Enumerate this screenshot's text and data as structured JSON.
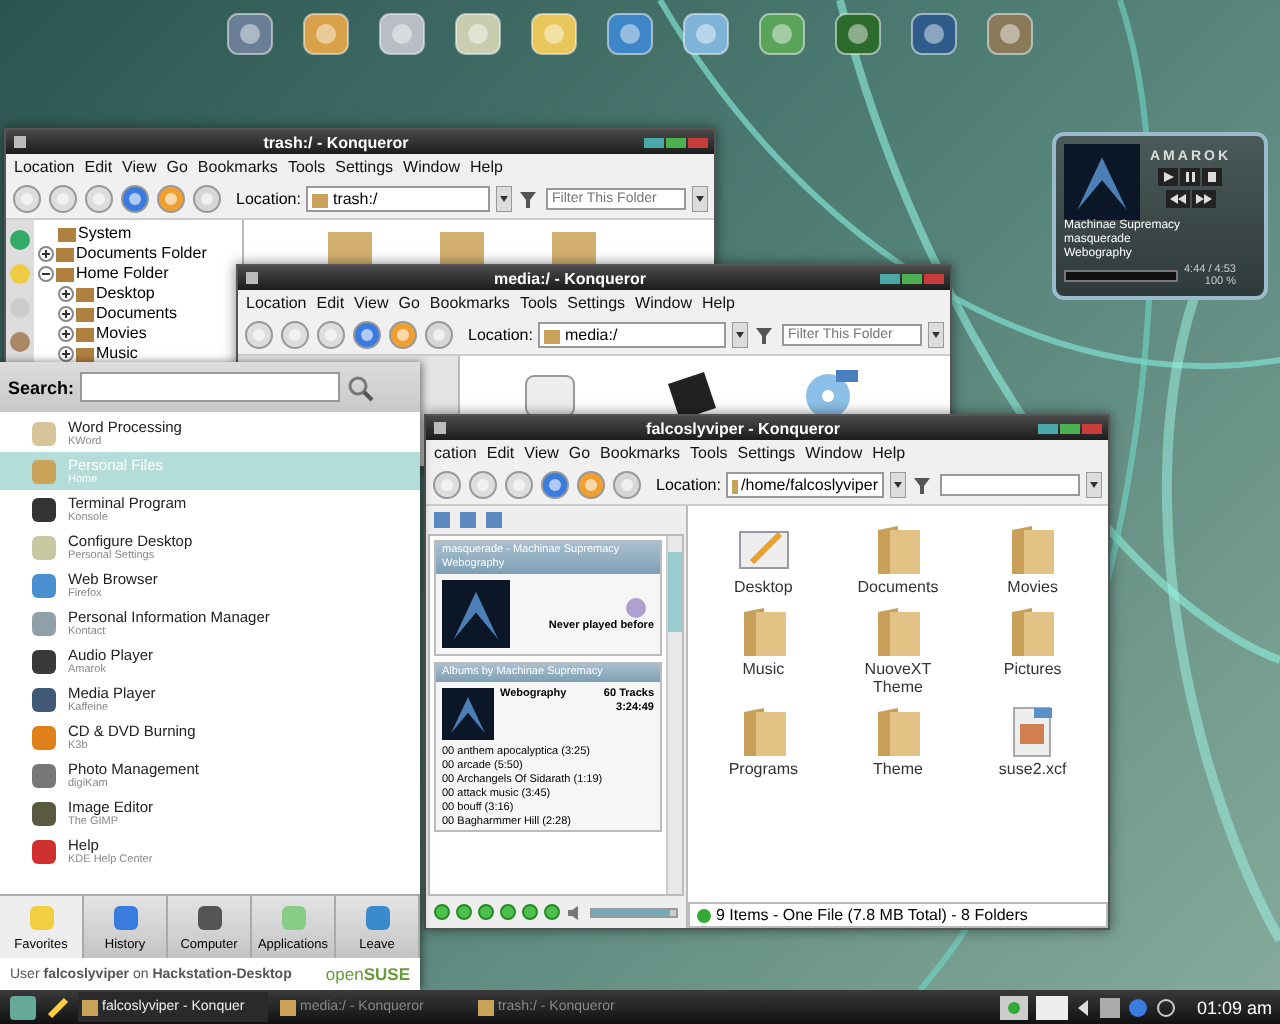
{
  "amarok_widget": {
    "logo": "AMAROK",
    "artist": "Machinae Supremacy",
    "track": "masquerade",
    "album": "Webography",
    "time": "4:44 / 4:53",
    "volume": "100 %"
  },
  "trash_window": {
    "title": "trash:/ - Konqueror",
    "menu": [
      "Location",
      "Edit",
      "View",
      "Go",
      "Bookmarks",
      "Tools",
      "Settings",
      "Window",
      "Help"
    ],
    "location_label": "Location:",
    "location": "trash:/",
    "filter_placeholder": "Filter This Folder",
    "tree": [
      {
        "label": "System"
      },
      {
        "label": "Documents Folder",
        "expanded": false
      },
      {
        "label": "Home Folder",
        "expanded": true,
        "children": [
          {
            "label": "Desktop",
            "expanded": false
          },
          {
            "label": "Documents",
            "expanded": false
          },
          {
            "label": "Movies",
            "expanded": false
          },
          {
            "label": "Music",
            "expanded": false
          }
        ]
      }
    ]
  },
  "media_window": {
    "title": "media:/ - Konqueror",
    "menu": [
      "Location",
      "Edit",
      "View",
      "Go",
      "Bookmarks",
      "Tools",
      "Settings",
      "Window",
      "Help"
    ],
    "location_label": "Location:",
    "location": "media:/",
    "filter_placeholder": "Filter This Folder"
  },
  "home_window": {
    "title": "falcoslyviper - Konqueror",
    "menu": [
      "cation",
      "Edit",
      "View",
      "Go",
      "Bookmarks",
      "Tools",
      "Settings",
      "Window",
      "Help"
    ],
    "location_label": "Location:",
    "location": "/home/falcoslyviper",
    "now_playing": {
      "header": "masquerade - Machinae Supremacy",
      "subheader": "Webography",
      "play_note": "Never played before"
    },
    "albums": {
      "header": "Albums by Machinae Supremacy",
      "album": "Webography",
      "track_count": "60 Tracks",
      "length": "3:24:49",
      "tracks": [
        "00  anthem apocalyptica (3:25)",
        "00  arcade (5:50)",
        "00  Archangels Of Sidarath (1:19)",
        "00  attack music (3:45)",
        "00  bouff (3:16)",
        "00  Bagharmmer Hill (2:28)"
      ]
    },
    "volume": {
      "level": 0.93
    },
    "files": [
      {
        "name": "Desktop",
        "kind": "desktop"
      },
      {
        "name": "Documents",
        "kind": "folder"
      },
      {
        "name": "Movies",
        "kind": "folder"
      },
      {
        "name": "Music",
        "kind": "folder"
      },
      {
        "name": "NuoveXT Theme",
        "kind": "folder"
      },
      {
        "name": "Pictures",
        "kind": "folder"
      },
      {
        "name": "Programs",
        "kind": "folder"
      },
      {
        "name": "Theme",
        "kind": "folder"
      },
      {
        "name": "suse2.xcf",
        "kind": "file"
      }
    ],
    "status": "9 Items - One File (7.8 MB Total) - 8 Folders"
  },
  "start_menu": {
    "search_label": "Search:",
    "items": [
      {
        "name": "Word Processing",
        "description": "KWord",
        "selected": false
      },
      {
        "name": "Personal Files",
        "description": "Home",
        "selected": true
      },
      {
        "name": "Terminal Program",
        "description": "Konsole",
        "selected": false
      },
      {
        "name": "Configure Desktop",
        "description": "Personal Settings",
        "selected": false
      },
      {
        "name": "Web Browser",
        "description": "Firefox",
        "selected": false
      },
      {
        "name": "Personal Information Manager",
        "description": "Kontact",
        "selected": false
      },
      {
        "name": "Audio Player",
        "description": "Amarok",
        "selected": false
      },
      {
        "name": "Media Player",
        "description": "Kaffeine",
        "selected": false
      },
      {
        "name": "CD & DVD Burning",
        "description": "K3b",
        "selected": false
      },
      {
        "name": "Photo Management",
        "description": "digiKam",
        "selected": false
      },
      {
        "name": "Image Editor",
        "description": "The GIMP",
        "selected": false
      },
      {
        "name": "Help",
        "description": "KDE Help Center",
        "selected": false
      }
    ],
    "tabs": [
      {
        "label": "Favorites",
        "selected": true
      },
      {
        "label": "History",
        "selected": false
      },
      {
        "label": "Computer",
        "selected": false
      },
      {
        "label": "Applications",
        "selected": false
      },
      {
        "label": "Leave",
        "selected": false
      }
    ],
    "footer": "User **falcoslyviper** on **Hackstation-Desktop**",
    "brand": "open**SUSE**"
  },
  "taskbar": {
    "tasks": [
      {
        "label": "falcoslyviper - Konquer",
        "selected": true
      },
      {
        "label": "media:/ - Konqueror",
        "selected": false
      },
      {
        "label": "trash:/ - Konqueror",
        "selected": false
      }
    ],
    "clock": "01:09 am"
  }
}
